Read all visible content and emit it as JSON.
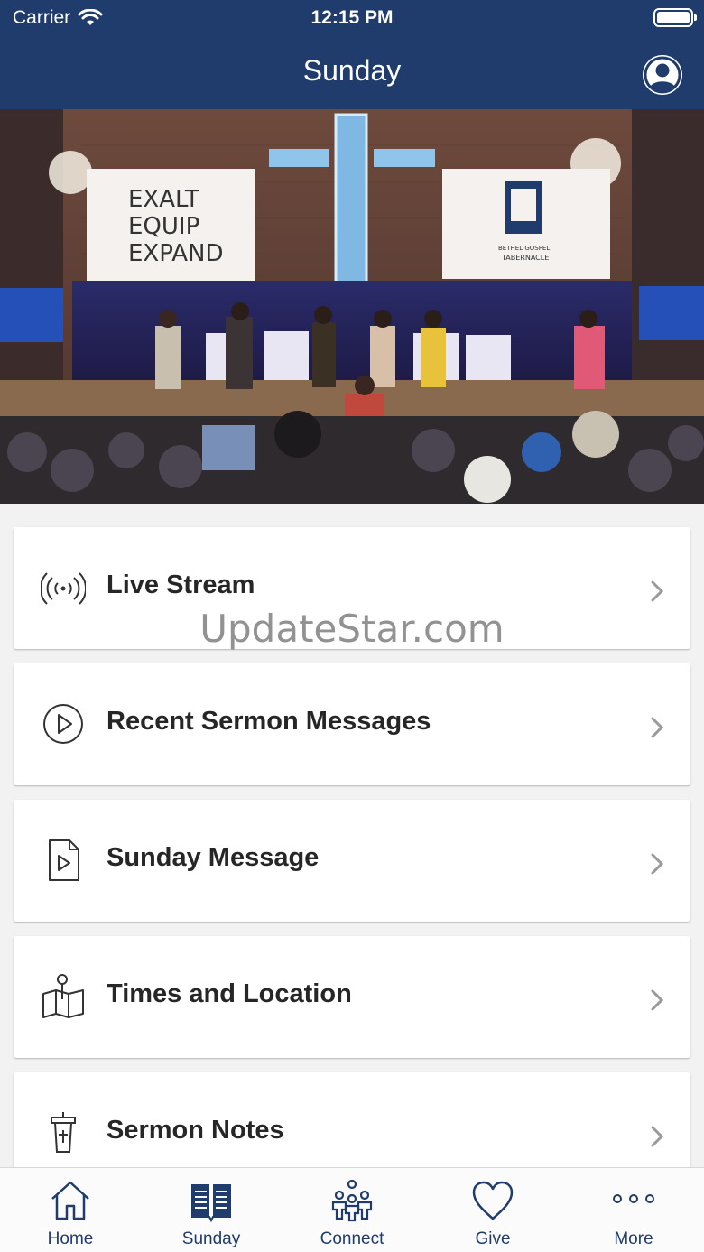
{
  "status_bar": {
    "carrier": "Carrier",
    "time": "12:15 PM"
  },
  "nav": {
    "title": "Sunday"
  },
  "hero": {
    "banner_left_lines": [
      "EXALT",
      "EQUIP",
      "EXPAND"
    ],
    "banner_right_lines": [
      "BETHEL GOSPEL",
      "TABERNACLE"
    ]
  },
  "menu": [
    {
      "label": "Live Stream",
      "icon": "broadcast-icon"
    },
    {
      "label": "Recent Sermon Messages",
      "icon": "play-circle-icon"
    },
    {
      "label": "Sunday Message",
      "icon": "video-file-icon"
    },
    {
      "label": "Times and Location",
      "icon": "map-pin-icon"
    },
    {
      "label": "Sermon Notes",
      "icon": "pulpit-icon"
    }
  ],
  "watermark": "UpdateStar.com",
  "tabs": [
    {
      "label": "Home",
      "icon": "home-icon"
    },
    {
      "label": "Sunday",
      "icon": "book-icon"
    },
    {
      "label": "Connect",
      "icon": "people-icon"
    },
    {
      "label": "Give",
      "icon": "heart-icon"
    },
    {
      "label": "More",
      "icon": "more-dots-icon"
    }
  ],
  "colors": {
    "brand": "#1f3c6c",
    "background": "#f2f2f2"
  }
}
